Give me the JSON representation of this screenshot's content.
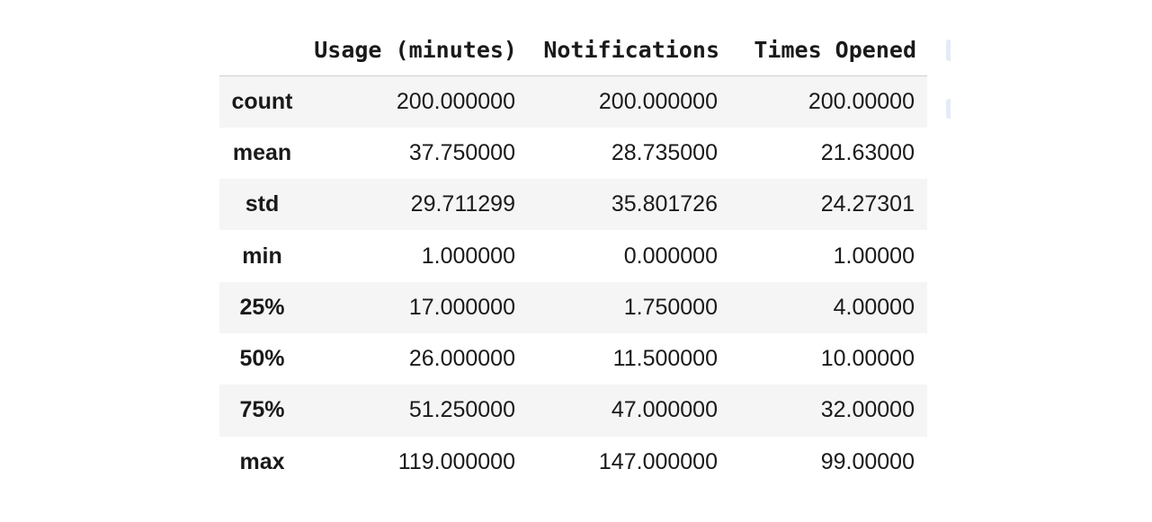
{
  "table": {
    "index_header": "",
    "columns": [
      "Usage (minutes)",
      "Notifications",
      "Times Opened"
    ],
    "rows": [
      {
        "label": "count",
        "values": [
          "200.000000",
          "200.000000",
          "200.00000"
        ]
      },
      {
        "label": "mean",
        "values": [
          "37.750000",
          "28.735000",
          "21.63000"
        ]
      },
      {
        "label": "std",
        "values": [
          "29.711299",
          "35.801726",
          "24.27301"
        ]
      },
      {
        "label": "min",
        "values": [
          "1.000000",
          "0.000000",
          "1.00000"
        ]
      },
      {
        "label": "25%",
        "values": [
          "17.000000",
          "1.750000",
          "4.00000"
        ]
      },
      {
        "label": "50%",
        "values": [
          "26.000000",
          "11.500000",
          "10.00000"
        ]
      },
      {
        "label": "75%",
        "values": [
          "51.250000",
          "47.000000",
          "32.00000"
        ]
      },
      {
        "label": "max",
        "values": [
          "119.000000",
          "147.000000",
          "99.00000"
        ]
      }
    ]
  },
  "colors": {
    "stripe": "#f5f5f5",
    "header_rule": "#cfcfcf",
    "text": "#1a1a1a",
    "clipped_control": "#e3ecf8"
  }
}
